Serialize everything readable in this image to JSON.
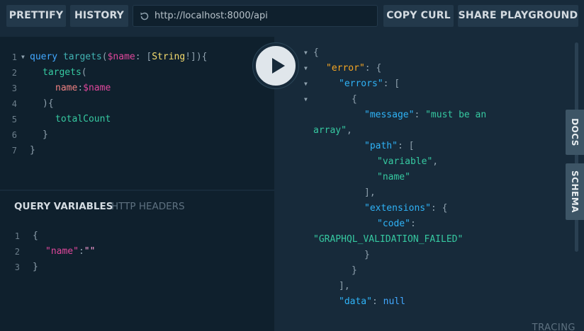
{
  "toolbar": {
    "prettify": "PRETTIFY",
    "history": "HISTORY",
    "url": "http://localhost:8000/api",
    "copy_curl": "COPY CURL",
    "share": "SHARE PLAYGROUND"
  },
  "query_editor": {
    "line_numbers": [
      "1",
      "2",
      "3",
      "4",
      "5",
      "6",
      "7"
    ],
    "line1": {
      "kw": "query",
      "name": "targets",
      "open": "(",
      "var": "$name",
      "colon": ": ",
      "lb": "[",
      "type": "String",
      "bang": "!",
      "rb": "]",
      "close": "){"
    },
    "line2": {
      "field": "targets",
      "open": "("
    },
    "line3": {
      "arg": "name",
      "colon": ":",
      "var": "$name"
    },
    "line4": {
      "text": "){"
    },
    "line5": {
      "field": "totalCount"
    },
    "line6": {
      "text": "}"
    },
    "line7": {
      "text": "}"
    }
  },
  "variables_tabs": {
    "query_variables": "QUERY VARIABLES",
    "http_headers": "HTTP HEADERS"
  },
  "variables_editor": {
    "line_numbers": [
      "1",
      "2",
      "3"
    ],
    "open": "{",
    "key": "\"name\"",
    "colon": ":",
    "value": "\"\"",
    "close": "}"
  },
  "result": {
    "l1": "{",
    "error_key": "\"error\"",
    "errors_key": "\"errors\"",
    "message_key": "\"message\"",
    "message_val_a": "\"must be an",
    "message_val_b": "array\"",
    "path_key": "\"path\"",
    "path_v1": "\"variable\"",
    "path_v2": "\"name\"",
    "extensions_key": "\"extensions\"",
    "code_key": "\"code\"",
    "code_val": "\"GRAPHQL_VALIDATION_FAILED\"",
    "data_key": "\"data\"",
    "data_val": "null"
  },
  "side_tabs": {
    "docs": "DOCS",
    "schema": "SCHEMA"
  },
  "footer": {
    "tracing": "TRACING"
  }
}
